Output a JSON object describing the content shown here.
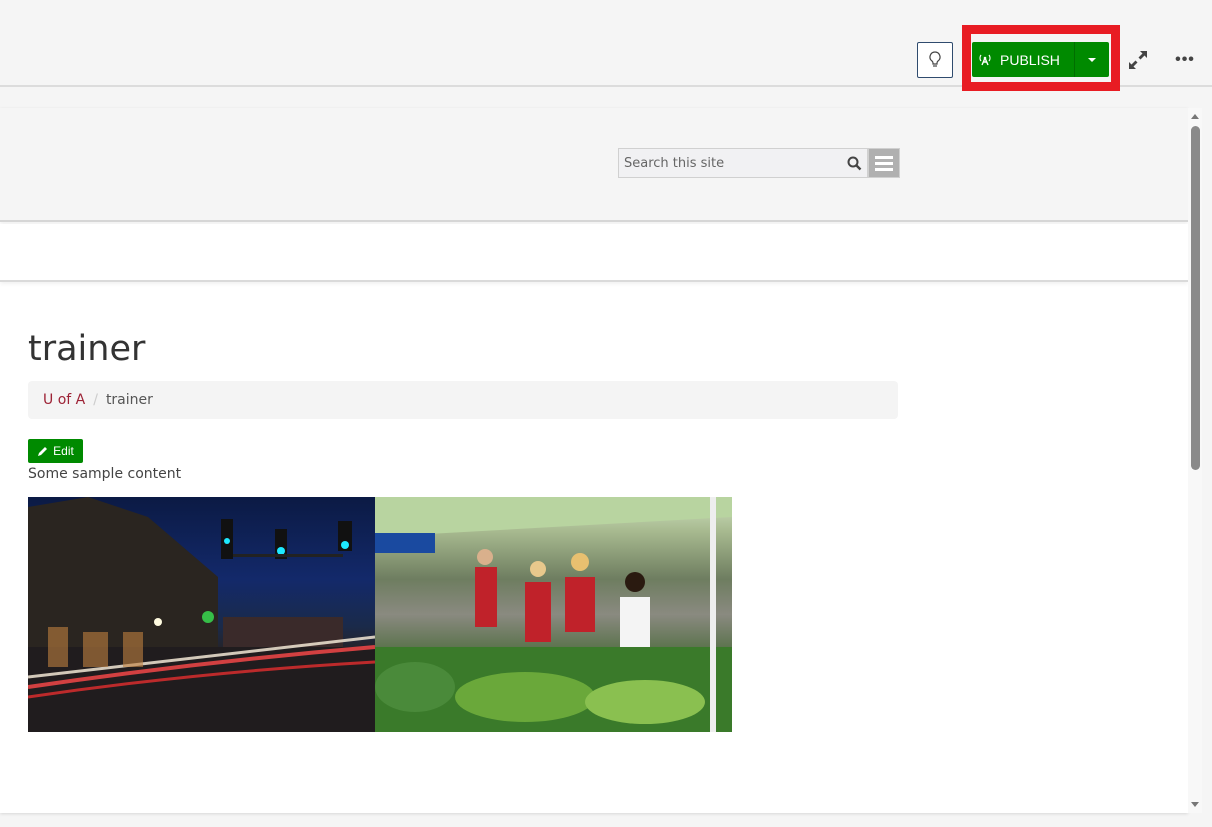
{
  "toolbar": {
    "publish_label": "PUBLISH",
    "icons": {
      "bulb": "lightbulb-icon",
      "publish": "broadcast-icon",
      "dropdown": "caret-down-icon",
      "expand": "expand-icon",
      "more": "more-horizontal-icon"
    },
    "more_label": "•••",
    "colors": {
      "publish": "#008a00",
      "highlight": "#e81c23"
    }
  },
  "site": {
    "search": {
      "placeholder": "Search this site",
      "value": ""
    }
  },
  "page": {
    "title": "trainer",
    "breadcrumb": [
      {
        "label": "U of A",
        "link": true
      },
      {
        "label": "trainer",
        "link": false
      }
    ],
    "breadcrumb_separator": "/",
    "edit_label": "Edit",
    "content": "Some sample content",
    "images": [
      {
        "alt": "Downtown street at night with traffic light trails"
      },
      {
        "alt": "Students at farmers market produce stand"
      }
    ],
    "colors": {
      "link": "#9d2235",
      "edit": "#008a00"
    }
  }
}
